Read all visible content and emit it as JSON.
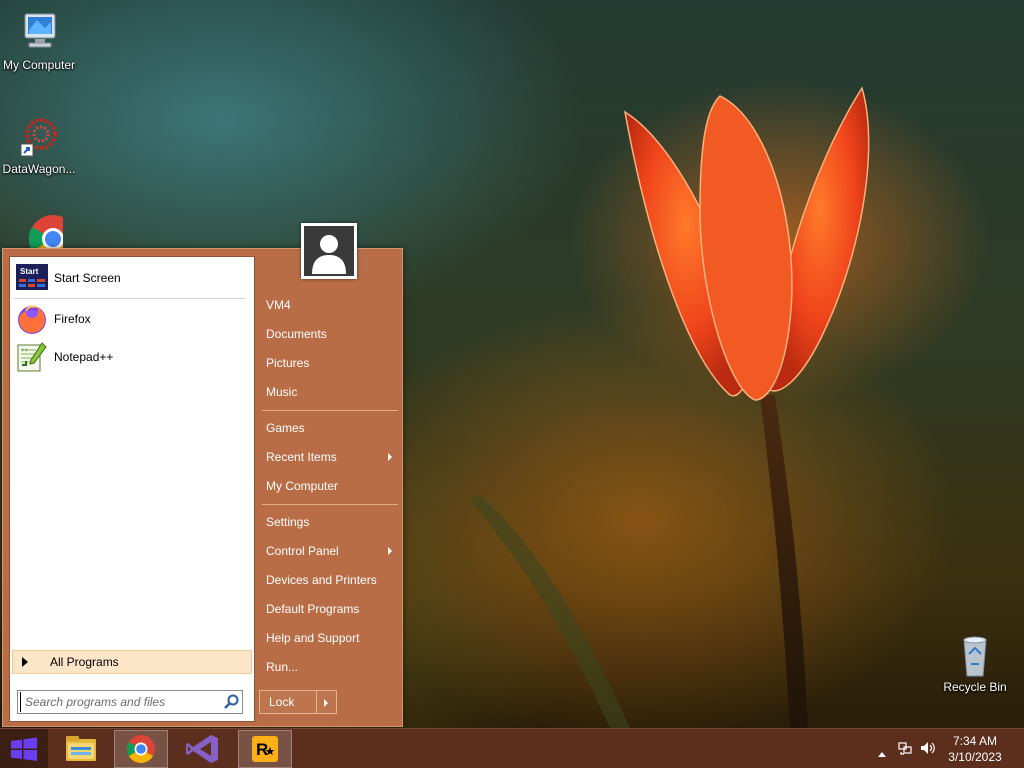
{
  "desktop": {
    "icons": [
      {
        "label": "My Computer",
        "icon": "my-computer-icon"
      },
      {
        "label": "DataWagon...",
        "icon": "datawagon-shortcut-icon"
      },
      {
        "label": "Recycle Bin",
        "icon": "recycle-bin-icon"
      }
    ]
  },
  "start_menu": {
    "pinned": [
      {
        "label": "Start Screen",
        "icon": "start-screen-icon",
        "icon_text": "Start"
      },
      {
        "label": "Firefox",
        "icon": "firefox-icon"
      },
      {
        "label": "Notepad++",
        "icon": "notepad-plus-plus-icon"
      }
    ],
    "all_programs": "All Programs",
    "search_placeholder": "Search programs and files",
    "right_items": [
      {
        "label": "VM4",
        "submenu": false
      },
      {
        "label": "Documents",
        "submenu": false
      },
      {
        "label": "Pictures",
        "submenu": false
      },
      {
        "label": "Music",
        "submenu": false
      },
      {
        "label": "Games",
        "submenu": false
      },
      {
        "label": "Recent Items",
        "submenu": true
      },
      {
        "label": "My Computer",
        "submenu": false
      },
      {
        "label": "Settings",
        "submenu": false
      },
      {
        "label": "Control Panel",
        "submenu": true
      },
      {
        "label": "Devices and Printers",
        "submenu": false
      },
      {
        "label": "Default Programs",
        "submenu": false
      },
      {
        "label": "Help and Support",
        "submenu": false
      },
      {
        "label": "Run...",
        "submenu": false
      }
    ],
    "lock_label": "Lock"
  },
  "taskbar": {
    "apps": [
      {
        "name": "File Explorer",
        "icon": "file-explorer-icon",
        "active": false
      },
      {
        "name": "Google Chrome",
        "icon": "chrome-icon",
        "active": true
      },
      {
        "name": "Visual Studio",
        "icon": "visual-studio-icon",
        "active": false
      },
      {
        "name": "Rockstar Games Launcher",
        "icon": "rockstar-icon",
        "active": true
      }
    ],
    "clock_time": "7:34 AM",
    "clock_date": "3/10/2023"
  },
  "colors": {
    "start_menu_bg": "#b86d46",
    "taskbar_bg": "#5b2e1d",
    "all_programs_highlight": "#fde6c8"
  }
}
